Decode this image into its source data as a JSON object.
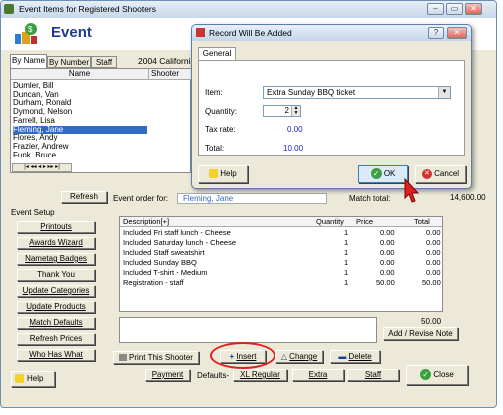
{
  "window": {
    "title": "Event Items for Registered Shooters",
    "minimize": "–",
    "restore": "▭",
    "close": "✕"
  },
  "header": {
    "title": "Event"
  },
  "tabs": [
    "By Name",
    "By Number",
    "Staff"
  ],
  "event_name": "2004 California",
  "list": {
    "col_name": "Name",
    "col_shooter": "Shooter Nu",
    "names": [
      "Dumler, Bill",
      "Duncan, Van",
      "Durham, Ronald",
      "Dymond, Nelson",
      "Farrell, Lisa",
      "Fleming, Jane",
      "Flores, Andy",
      "Frazier, Andrew",
      "Funk, Bruce"
    ],
    "selected_index": 5,
    "nav": "|◂ ◂◂ ◂ ▸ ▸▸ ▸|"
  },
  "refresh_label": "Refresh",
  "event_order_for_label": "Event order for:",
  "event_order_for_value": "Fleming, Jane",
  "match_total_label": "Match total:",
  "match_total_value": "14,600.00",
  "event_setup": {
    "label": "Event Setup",
    "buttons": [
      "Printouts",
      "Awards Wizard",
      "Nametag Badges",
      "Thank You",
      "Update Categories",
      "Update Products",
      "Match Defaults",
      "Refresh Prices",
      "Who Has What"
    ]
  },
  "help_label": "Help",
  "order": {
    "headers": {
      "description": "Description[+]",
      "quantity": "Quantity",
      "price": "Price",
      "total": "Total"
    },
    "rows": [
      {
        "desc": "Included Fri staff lunch - Cheese",
        "qty": "1",
        "price": "0.00",
        "total": "0.00"
      },
      {
        "desc": "Included Saturday lunch - Cheese",
        "qty": "1",
        "price": "0.00",
        "total": "0.00"
      },
      {
        "desc": "Included Staff sweatshirt",
        "qty": "1",
        "price": "0.00",
        "total": "0.00"
      },
      {
        "desc": "Included Sunday BBQ",
        "qty": "1",
        "price": "0.00",
        "total": "0.00"
      },
      {
        "desc": "Included T-shirt - Medium",
        "qty": "1",
        "price": "0.00",
        "total": "0.00"
      },
      {
        "desc": "Registration - staff",
        "qty": "1",
        "price": "50.00",
        "total": "50.00"
      }
    ],
    "grand_total": "50.00"
  },
  "add_revise_note": "Add / Revise Note",
  "actions": {
    "print": "Print This Shooter",
    "insert": "Insert",
    "change": "Change",
    "delete": "Delete"
  },
  "bottom": {
    "payment": "Payment",
    "defaults": "Defaults-",
    "xl_regular": "XL Regular",
    "extra": "Extra",
    "staff": "Staff",
    "close": "Close"
  },
  "dialog": {
    "title": "Record Will Be Added",
    "help_btn": "?",
    "close_btn": "✕",
    "tab": "General",
    "item_label": "Item:",
    "item_value": "Extra Sunday BBQ ticket",
    "quantity_label": "Quantity:",
    "quantity_value": "2",
    "tax_label": "Tax rate:",
    "tax_value": "0.00",
    "total_label": "Total:",
    "total_value": "10.00",
    "help": "Help",
    "ok": "OK",
    "cancel": "Cancel"
  },
  "colors": {
    "accent_red": "#e02020",
    "selected_blue": "#316ac5",
    "link_blue": "#1c1cc8"
  }
}
